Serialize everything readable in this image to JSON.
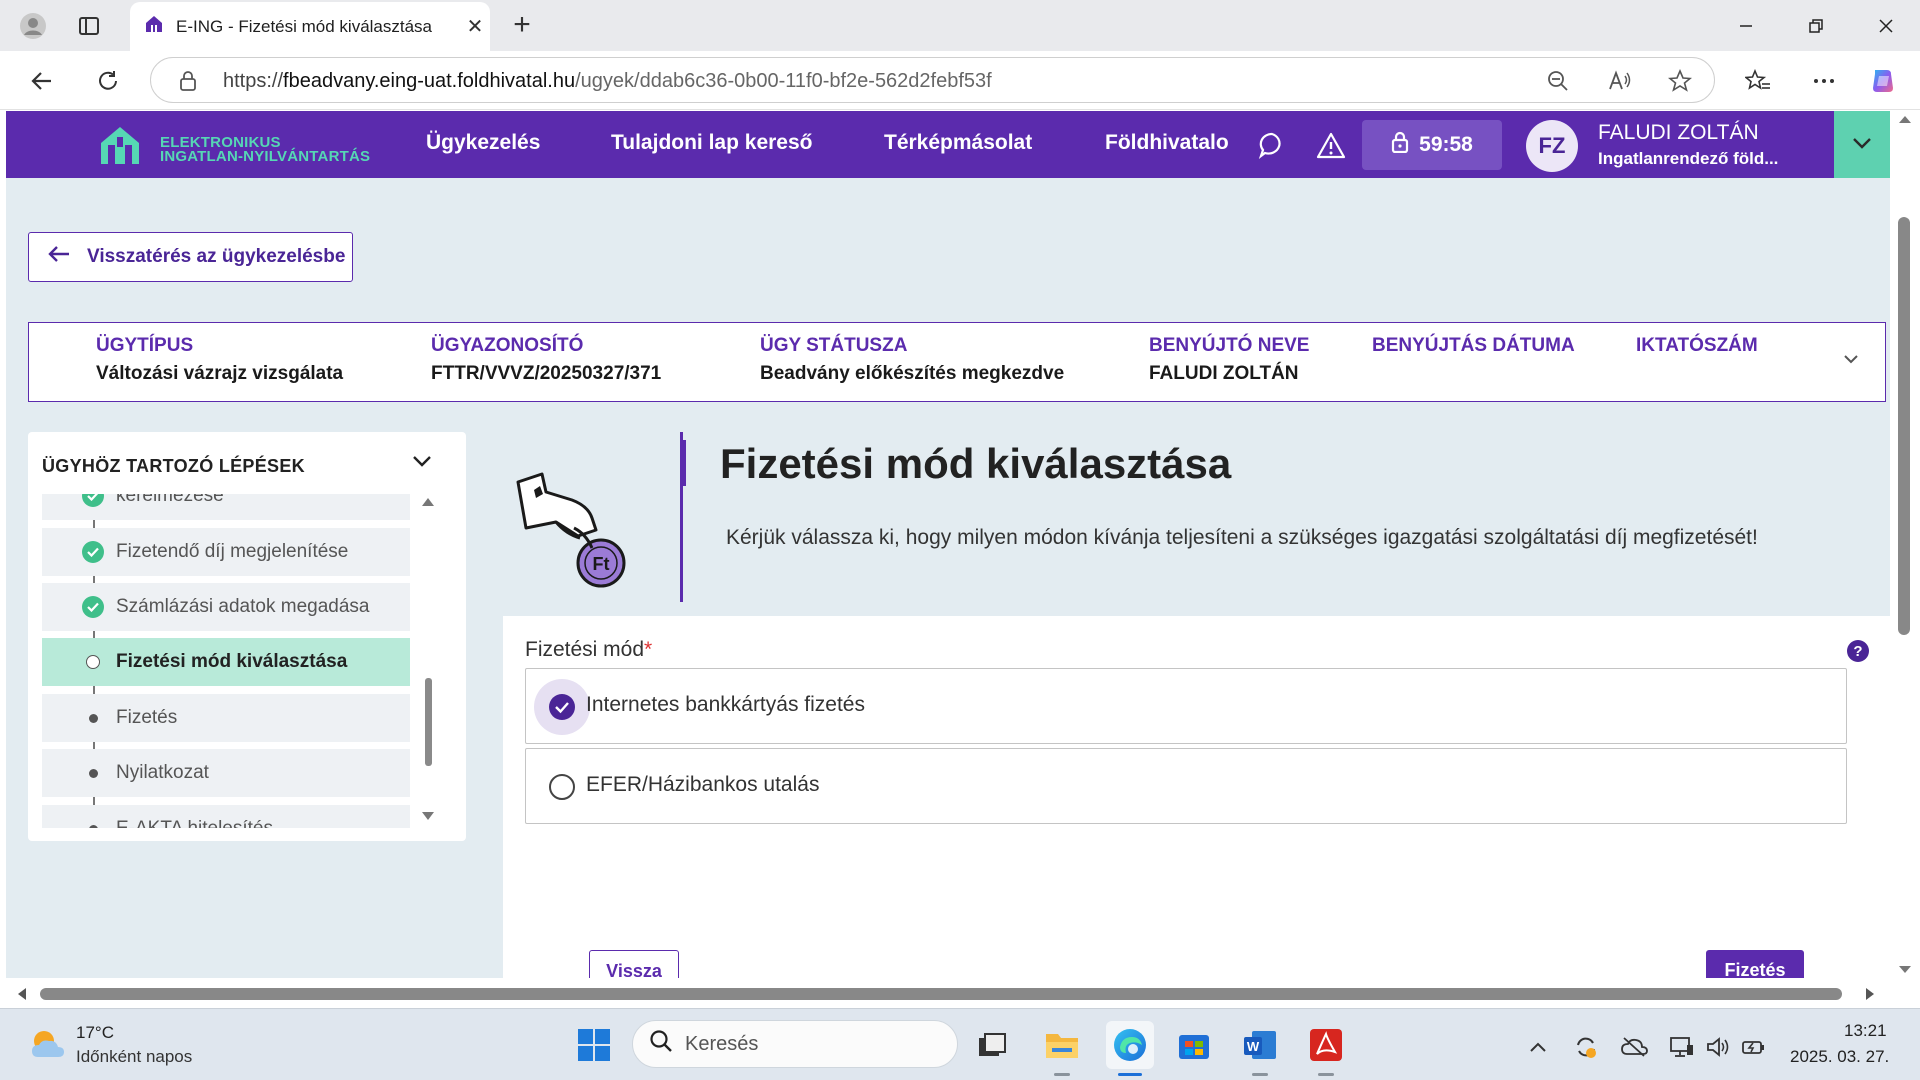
{
  "browser": {
    "tab_title": "E-ING - Fizetési mód kiválasztása",
    "tab_close": "✕",
    "new_tab": "+",
    "url_prefix": "https://",
    "url_host": "fbeadvany.eing-uat.foldhivatal.hu",
    "url_path": "/ugyek/ddab6c36-0b00-11f0-bf2e-562d2febf53f",
    "window_controls": [
      "minimize-icon",
      "restore-icon",
      "close-icon"
    ]
  },
  "site_header": {
    "logo_line1": "ELEKTRONIKUS",
    "logo_line2": "INGATLAN-NYILVÁNTARTÁS",
    "menu": [
      "Ügykezelés",
      "Tulajdoni lap kereső",
      "Térképmásolat",
      "Földhivatalo"
    ],
    "timer": "59:58",
    "avatar_initials": "FZ",
    "user_name": "FALUDI ZOLTÁN",
    "user_role": "Ingatlanrendező föld...",
    "colors": {
      "brand": "#5b2bad",
      "accent": "#5ed1b0"
    }
  },
  "back_button": "Visszatérés az ügykezelésbe",
  "case": {
    "columns": [
      {
        "label": "ÜGYTÍPUS",
        "value": "Változási vázrajz vizsgálata"
      },
      {
        "label": "ÜGYAZONOSÍTÓ",
        "value": "FTTR/VVVZ/20250327/371"
      },
      {
        "label": "ÜGY STÁTUSZA",
        "value": "Beadvány előkészítés megkezdve"
      },
      {
        "label": "BENYÚJTÓ NEVE",
        "value": "FALUDI ZOLTÁN"
      },
      {
        "label": "BENYÚJTÁS DÁTUMA",
        "value": ""
      },
      {
        "label": "IKTATÓSZÁM",
        "value": ""
      }
    ]
  },
  "steps": {
    "title": "ÜGYHÖZ TARTOZÓ LÉPÉSEK",
    "items": [
      {
        "label": "kérelmezése",
        "status": "done"
      },
      {
        "label": "Fizetendő díj megjelenítése",
        "status": "done"
      },
      {
        "label": "Számlázási adatok megadása",
        "status": "done"
      },
      {
        "label": "Fizetési mód kiválasztása",
        "status": "current"
      },
      {
        "label": "Fizetés",
        "status": "pending"
      },
      {
        "label": "Nyilatkozat",
        "status": "pending"
      },
      {
        "label": "E-AKTA hitelesítés",
        "status": "pending"
      }
    ]
  },
  "main": {
    "title": "Fizetési mód kiválasztása",
    "description": "Kérjük válassza ki, hogy milyen módon kívánja teljesíteni a szükséges igazgatási szolgáltatási díj megfizetését!",
    "icon_label": "Ft",
    "form_label": "Fizetési mód",
    "required_mark": "*",
    "help": "?",
    "options": [
      {
        "label": "Internetes bankkártyás fizetés",
        "selected": true
      },
      {
        "label": "EFER/Házibankos utalás",
        "selected": false
      }
    ],
    "back_label": "Vissza",
    "pay_label": "Fizetés"
  },
  "taskbar": {
    "weather_temp": "17°C",
    "weather_desc": "Időnként napos",
    "search_placeholder": "Keresés",
    "time": "13:21",
    "date": "2025. 03. 27."
  }
}
